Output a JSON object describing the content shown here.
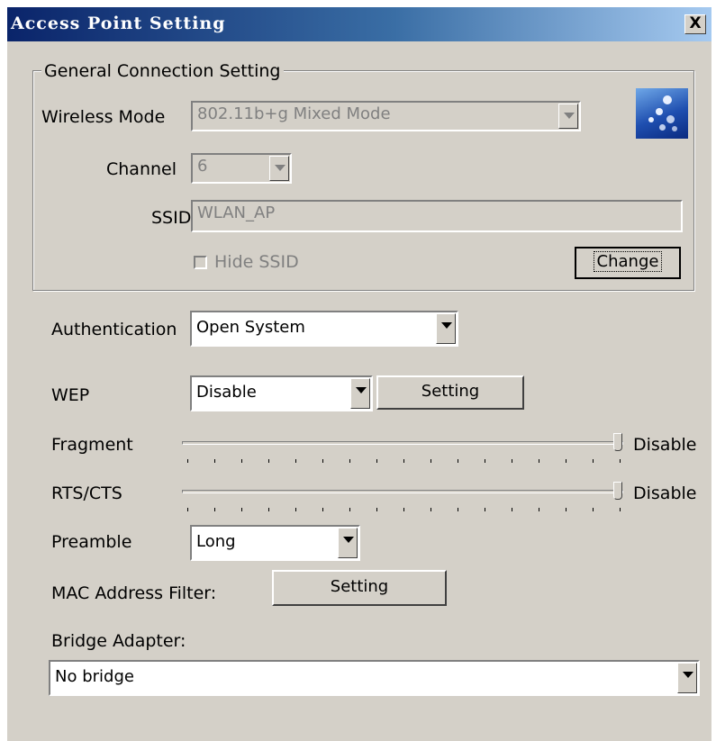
{
  "window": {
    "title": "Access Point Setting",
    "close_label": "X"
  },
  "general": {
    "group_title": "General Connection Setting",
    "wireless_mode": {
      "label": "Wireless Mode",
      "value": "802.11b+g Mixed Mode"
    },
    "channel": {
      "label": "Channel",
      "value": "6"
    },
    "ssid": {
      "label": "SSID",
      "value": "WLAN_AP"
    },
    "hide_ssid": {
      "label": "Hide SSID",
      "checked": false
    },
    "change_label": "Change",
    "logo_icon": "wireless-network-icon"
  },
  "authentication": {
    "label": "Authentication",
    "value": "Open System"
  },
  "wep": {
    "label": "WEP",
    "value": "Disable",
    "setting_label": "Setting"
  },
  "fragment": {
    "label": "Fragment",
    "value_label": "Disable",
    "level": 1.0
  },
  "rts_cts": {
    "label": "RTS/CTS",
    "value_label": "Disable",
    "level": 1.0
  },
  "preamble": {
    "label": "Preamble",
    "value": "Long"
  },
  "mac_filter": {
    "label": "MAC Address Filter:",
    "setting_label": "Setting"
  },
  "bridge": {
    "label": "Bridge Adapter:",
    "value": "No bridge"
  },
  "colors": {
    "title_start": "#0a246a",
    "title_end": "#a6caf0",
    "face": "#d4d0c8"
  }
}
